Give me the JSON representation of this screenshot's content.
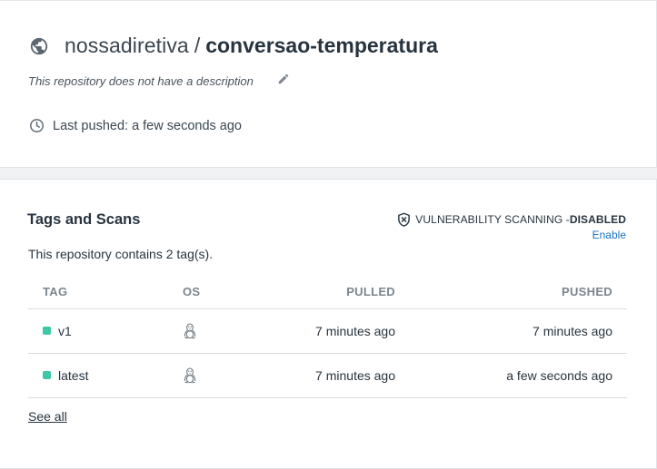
{
  "repo": {
    "namespace": "nossadiretiva",
    "separator": "/",
    "name": "conversao-temperatura",
    "description": "This repository does not have a description",
    "last_pushed": "Last pushed: a few seconds ago"
  },
  "tags_section": {
    "title": "Tags and Scans",
    "vulnerability_prefix": "VULNERABILITY SCANNING - ",
    "vulnerability_status": "DISABLED",
    "enable_label": "Enable",
    "contains_text": "This repository contains 2 tag(s).",
    "columns": {
      "tag": "TAG",
      "os": "OS",
      "pulled": "PULLED",
      "pushed": "PUSHED"
    },
    "rows": [
      {
        "tag": "v1",
        "os_icon": "linux-icon",
        "pulled": "7 minutes ago",
        "pushed": "7 minutes ago"
      },
      {
        "tag": "latest",
        "os_icon": "linux-icon",
        "pulled": "7 minutes ago",
        "pushed": "a few seconds ago"
      }
    ],
    "see_all_label": "See all"
  },
  "colors": {
    "tag_dot": "#3ec7a4",
    "link": "#1a73c8",
    "background": "#f1f2f3"
  }
}
